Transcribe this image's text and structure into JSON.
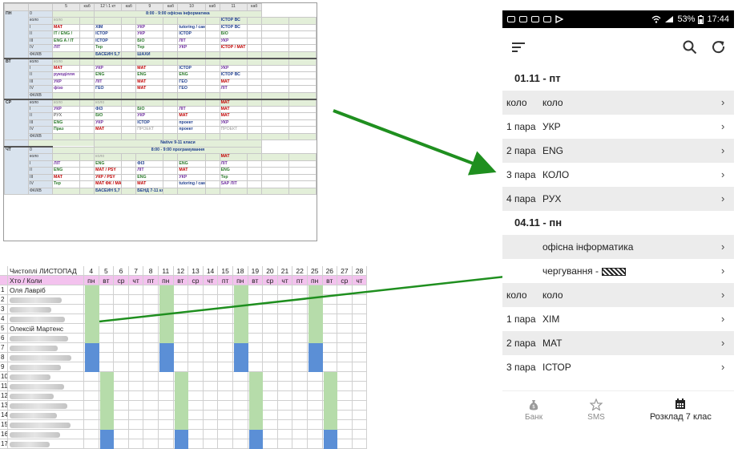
{
  "timetable": {
    "header_cells": [
      "",
      "",
      "5",
      "каб",
      "12 \\ 1 кт",
      "каб",
      "9",
      "каб",
      "10",
      "каб",
      "11",
      "каб"
    ],
    "notes": {
      "morning_it": "8:00 - 9:00 офісна інформатика",
      "native": "Native 9-11 класи",
      "morning_prog": "8:00 - 9:00 програмування"
    },
    "days": [
      {
        "name": "ПН",
        "rows": [
          {
            "n": "0",
            "cells": [
              "",
              "",
              "",
              "",
              "",
              ""
            ]
          },
          {
            "n": "коло",
            "cells": [
              "коло",
              "",
              "",
              "",
              "ІСТОР ВС",
              ""
            ]
          },
          {
            "n": "I",
            "cells": [
              "МАТ",
              "ХІМ",
              "УКР",
              "tutoring / самоучка",
              "ІСТОР ВС",
              ""
            ]
          },
          {
            "n": "II",
            "cells": [
              "IT / ENG /",
              "ІСТОР",
              "УКР",
              "ІСТОР",
              "БІО",
              ""
            ]
          },
          {
            "n": "III",
            "cells": [
              "ENG A / IT",
              "ІСТОР",
              "БІО",
              "ЛІТ",
              "УКР",
              ""
            ]
          },
          {
            "n": "IV",
            "cells": [
              "ЛІТ",
              "Тер",
              "Тер",
              "УКР",
              "ІСТОР / МАТ",
              ""
            ]
          },
          {
            "n": "ФК/КВ",
            "cells": [
              "",
              "БАСЕЙН 5,7 кл",
              "ШАХИ",
              "",
              "",
              ""
            ]
          }
        ]
      },
      {
        "name": "ВТ",
        "rows": [
          {
            "n": "коло",
            "cells": [
              "коло",
              "",
              "",
              "",
              "",
              ""
            ]
          },
          {
            "n": "I",
            "cells": [
              "МАТ",
              "УКР",
              "МАТ",
              "ІСТОР",
              "УКР",
              ""
            ]
          },
          {
            "n": "II",
            "cells": [
              "рукоділля",
              "ENG",
              "ENG",
              "ENG",
              "ІСТОР ВС",
              ""
            ]
          },
          {
            "n": "III",
            "cells": [
              "УКР",
              "ЛІТ",
              "МАТ",
              "ГЕО",
              "МАТ",
              ""
            ]
          },
          {
            "n": "IV",
            "cells": [
              "фізо",
              "ГЕО",
              "МАТ",
              "ГЕО",
              "ЛІТ",
              ""
            ]
          },
          {
            "n": "ФК/КВ",
            "cells": [
              "",
              "",
              "",
              "",
              "",
              ""
            ]
          }
        ]
      },
      {
        "name": "СР",
        "rows": [
          {
            "n": "коло",
            "cells": [
              "коло",
              "коло",
              "",
              "",
              "МАТ",
              ""
            ]
          },
          {
            "n": "I",
            "cells": [
              "УКР",
              "ФІЗ",
              "БІО",
              "ЛІТ",
              "МАТ",
              ""
            ]
          },
          {
            "n": "II",
            "cells": [
              "РУХ",
              "БІО",
              "УКР",
              "МАТ",
              "МАТ",
              ""
            ]
          },
          {
            "n": "III",
            "cells": [
              "ENG",
              "УКР",
              "ІСТОР",
              "проект",
              "УКР",
              ""
            ]
          },
          {
            "n": "IV",
            "cells": [
              "Праз",
              "МАТ",
              "ПРОЕКТ",
              "проект",
              "ПРОЕКТ",
              ""
            ]
          },
          {
            "n": "ФК/КВ",
            "cells": [
              "",
              "",
              "",
              "",
              "",
              ""
            ]
          }
        ]
      },
      {
        "name": "ЧТ",
        "rows": [
          {
            "n": "0",
            "cells": [
              "",
              "",
              "",
              "",
              "",
              ""
            ]
          },
          {
            "n": "коло",
            "cells": [
              "",
              "коло",
              "",
              "",
              "МАТ",
              ""
            ]
          },
          {
            "n": "I",
            "cells": [
              "ЛІТ",
              "ENG",
              "ФІЗ",
              "ENG",
              "ЛІТ",
              ""
            ]
          },
          {
            "n": "II",
            "cells": [
              "ENG",
              "МАТ / PSY",
              "ЛІТ",
              "МАТ",
              "ENG",
              ""
            ]
          },
          {
            "n": "III",
            "cells": [
              "МАТ",
              "УКР / PSY",
              "ENG",
              "УКР",
              "Тер",
              ""
            ]
          },
          {
            "n": "IV",
            "cells": [
              "Тер",
              "МАТ ФК / МАТ",
              "МАТ",
              "tutoring / самоучка",
              "SAP ЛІТ",
              ""
            ]
          },
          {
            "n": "ФК/КВ",
            "cells": [
              "",
              "БАСЕЙН 5,7 кл",
              "БЕНД 7-11 кл",
              "",
              "",
              ""
            ]
          }
        ]
      }
    ]
  },
  "sheet": {
    "title": "Чистоплі ЛИСТОПАД",
    "subtitle": "Хто / Коли",
    "dates": [
      "4",
      "5",
      "6",
      "7",
      "8",
      "11",
      "12",
      "13",
      "14",
      "15",
      "18",
      "19",
      "20",
      "21",
      "22",
      "25",
      "26",
      "27",
      "28"
    ],
    "weekdays": [
      "пн",
      "вт",
      "ср",
      "чт",
      "пт",
      "пн",
      "вт",
      "ср",
      "чт",
      "пт",
      "пн",
      "вт",
      "ср",
      "чт",
      "пт",
      "пн",
      "вт",
      "ср",
      "чт"
    ],
    "row_numbers": [
      "1",
      "2",
      "3",
      "4",
      "5",
      "6",
      "7",
      "8",
      "9",
      "10",
      "11",
      "12",
      "13",
      "14",
      "15",
      "16",
      "17"
    ],
    "visible_names": [
      "Оля Лавріб",
      "",
      "",
      "",
      "Олексій Мартенс",
      "",
      "",
      "",
      "",
      "",
      "",
      "",
      "",
      "",
      "",
      "",
      ""
    ],
    "colors": {
      "green": "#b6dcaa",
      "blue": "#5b8fd6",
      "header_pink": "#f3c2ee"
    }
  },
  "phone": {
    "status": {
      "battery": "53%",
      "time": "17:44"
    },
    "days": [
      {
        "date": "01.11 - пт",
        "items": [
          {
            "label": "коло",
            "subject": "коло"
          },
          {
            "label": "1 пара",
            "subject": "УКР"
          },
          {
            "label": "2 пара",
            "subject": "ENG"
          },
          {
            "label": "3 пара",
            "subject": "КОЛО"
          },
          {
            "label": "4 пара",
            "subject": "РУХ"
          }
        ]
      },
      {
        "date": "04.11 - пн",
        "items": [
          {
            "label": "",
            "subject": "офісна інформатика"
          },
          {
            "label": "",
            "subject": "чергування -"
          },
          {
            "label": "коло",
            "subject": "коло"
          },
          {
            "label": "1 пара",
            "subject": "ХІМ"
          },
          {
            "label": "2 пара",
            "subject": "МАТ"
          },
          {
            "label": "3 пара",
            "subject": "ІСТОР"
          }
        ]
      }
    ],
    "bottom_nav": [
      {
        "label": "Банк",
        "icon": "money-bag-icon"
      },
      {
        "label": "SMS",
        "icon": "star-icon"
      },
      {
        "label": "Розклад 7 клас",
        "icon": "calendar-icon"
      }
    ],
    "arrow_color": "#1f8f1f"
  }
}
